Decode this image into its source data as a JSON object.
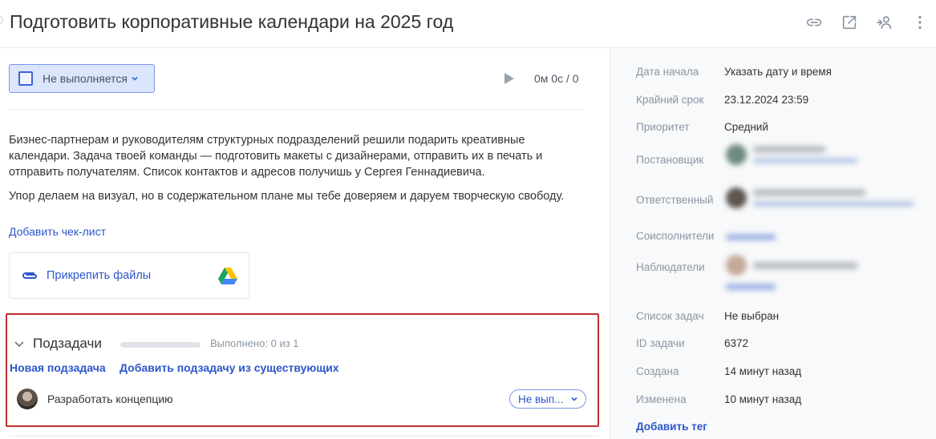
{
  "task": {
    "title": "Подготовить корпоративные календари на 2025 год"
  },
  "header_icons": [
    "link-icon",
    "open-external-icon",
    "add-person-icon",
    "more-vertical-icon"
  ],
  "status": {
    "label": "Не выполняется"
  },
  "timer": {
    "value": "0м 0с / 0"
  },
  "description": {
    "paragraph1": "Бизнес-партнерам и руководителям структурных подразделений решили подарить креативные календари. Задача твоей команды — подготовить макеты с дизайнерами, отправить их в печать и отправить получателям. Список контактов и адресов получишь у Сергея Геннадиевича.",
    "paragraph2": "Упор делаем на визуал, но в содержательном плане мы тебе доверяем и даруем творческую свободу."
  },
  "checklist": {
    "add_label": "Добавить чек-лист"
  },
  "attachments": {
    "label": "Прикрепить файлы"
  },
  "subtasks": {
    "title": "Подзадачи",
    "progress": 0,
    "progress_text": "Выполнено: 0 из 1",
    "new_label": "Новая подзадача",
    "add_existing_label": "Добавить подзадачу из существующих",
    "items": [
      {
        "name": "Разработать концепцию",
        "status": "Не вып..."
      }
    ]
  },
  "sidebar": {
    "start_date": {
      "label": "Дата начала",
      "value": "Указать дату и время"
    },
    "deadline": {
      "label": "Крайний срок",
      "value": "23.12.2024  23:59"
    },
    "priority": {
      "label": "Приоритет",
      "value": "Средний"
    },
    "creator": {
      "label": "Постановщик"
    },
    "responsible": {
      "label": "Ответственный"
    },
    "coexecutors": {
      "label": "Соисполнители"
    },
    "observers": {
      "label": "Наблюдатели"
    },
    "task_list": {
      "label": "Список задач",
      "value": "Не выбран"
    },
    "task_id": {
      "label": "ID задачи",
      "value": "6372"
    },
    "created": {
      "label": "Создана",
      "value": "14 минут назад"
    },
    "modified": {
      "label": "Изменена",
      "value": "10 минут назад"
    },
    "add_tag_label": "Добавить тег"
  },
  "colors": {
    "accent": "#2d56c9",
    "highlight_border": "#c0312b",
    "status_bg": "#dbe5fb"
  }
}
